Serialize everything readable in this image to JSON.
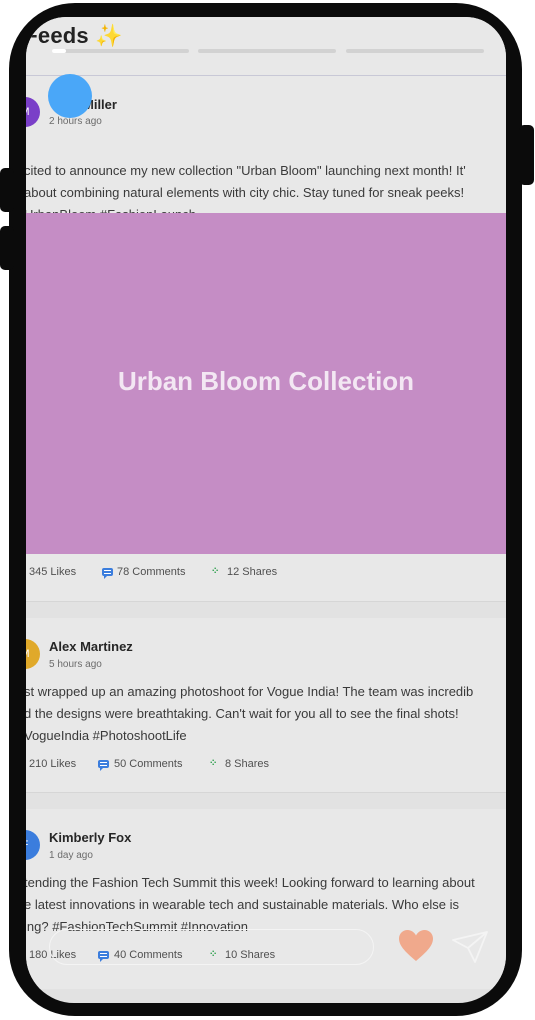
{
  "header": {
    "title": "st Feeds",
    "sparkle": "✨"
  },
  "posts": [
    {
      "author": "Miller",
      "avatar_initial": "M",
      "avatar_color": "#7a3fc8",
      "time": "2 hours ago",
      "lines": [
        "cited to announce my new collection \"Urban Bloom\" launching next month! It'",
        " about combining natural elements with city chic. Stay tuned for sneak peeks!",
        "UrbanBloom #FashionLaunch"
      ],
      "image_title": "Urban Bloom Collection",
      "likes": "345 Likes",
      "comments": "78 Comments",
      "shares": "12 Shares"
    },
    {
      "author": "Alex Martinez",
      "avatar_initial": "M",
      "avatar_color": "#e0a92a",
      "time": "5 hours ago",
      "lines": [
        "st wrapped up an amazing photoshoot for Vogue India! The team was incredib",
        "d the designs were breathtaking. Can't wait for you all to see the final shots!",
        "VogueIndia #PhotoshootLife"
      ],
      "likes": "210 Likes",
      "comments": "50 Comments",
      "shares": "8 Shares"
    },
    {
      "author": "Kimberly Fox",
      "avatar_initial": "F",
      "avatar_color": "#3b7ddd",
      "time": "1 day ago",
      "lines": [
        "tending the Fashion Tech Summit this week! Looking forward to learning about",
        "e latest innovations in wearable tech and sustainable materials. Who else is",
        "ing? #FashionTechSummit #Innovation"
      ],
      "likes": "180 Likes",
      "comments": "40 Comments",
      "shares": "10 Shares"
    }
  ],
  "colors": {
    "accent": "#3b7ddd",
    "share": "#31a150",
    "heart": "#f0a98c",
    "image_bg": "#c58dc5"
  },
  "icons": {
    "heart": "heart-icon",
    "send": "send-icon",
    "comment": "comment-icon",
    "share": "share-icon"
  }
}
